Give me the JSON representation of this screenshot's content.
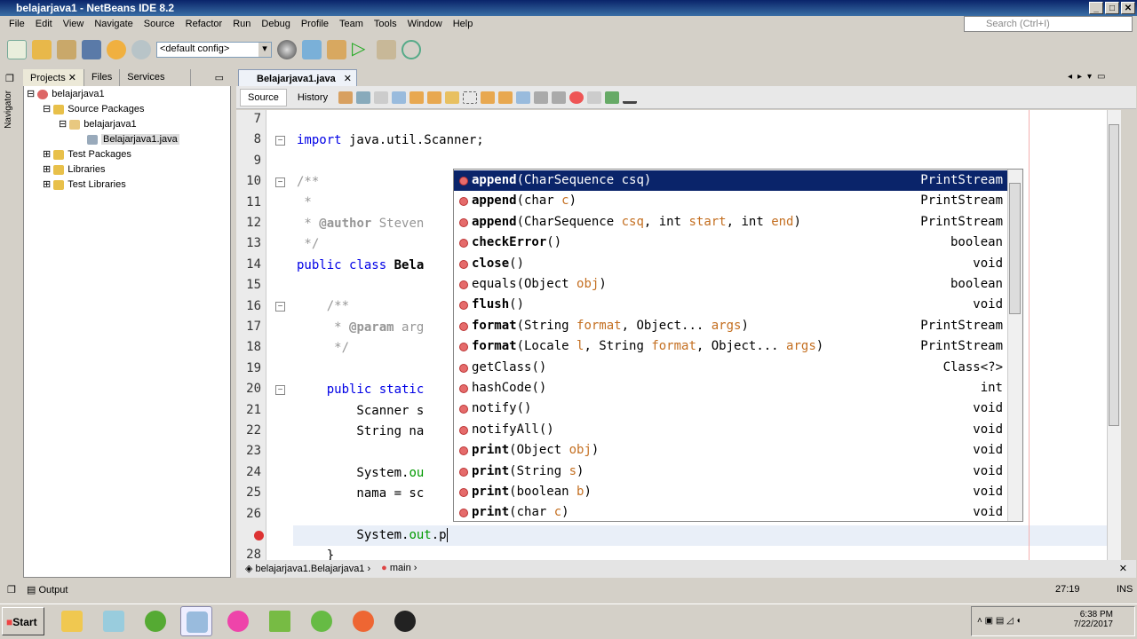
{
  "window": {
    "title": "belajarjava1 - NetBeans IDE 8.2"
  },
  "menu": [
    "File",
    "Edit",
    "View",
    "Navigate",
    "Source",
    "Refactor",
    "Run",
    "Debug",
    "Profile",
    "Team",
    "Tools",
    "Window",
    "Help"
  ],
  "search": {
    "placeholder": "Search (Ctrl+I)"
  },
  "toolbar": {
    "config": "<default config>"
  },
  "left_tabs": [
    "Projects",
    "Files",
    "Services"
  ],
  "navigator_label": "Navigator",
  "tree": [
    "belajarjava1",
    "Source Packages",
    "belajarjava1",
    "Belajarjava1.java",
    "Test Packages",
    "Libraries",
    "Test Libraries"
  ],
  "editor": {
    "tab": "Belajarjava1.java",
    "view_tabs": [
      "Source",
      "History"
    ],
    "line_numbers": [
      "7",
      "8",
      "9",
      "10",
      "11",
      "12",
      "13",
      "14",
      "15",
      "16",
      "17",
      "18",
      "19",
      "20",
      "21",
      "22",
      "23",
      "24",
      "25",
      "26",
      "",
      "28"
    ],
    "code": {
      "l8a": "import",
      "l8b": " java.util.Scanner;",
      "l10": "/**",
      "l11": " *",
      "l12a": " * ",
      "l12b": "@author",
      "l12c": " Steven",
      "l13": " */",
      "l14a": "public class ",
      "l14b": "Bela",
      "l16": "    /**",
      "l17a": "     * ",
      "l17b": "@param",
      "l17c": " arg",
      "l18": "     */",
      "l20": "    public static",
      "l21": "        Scanner s",
      "l22": "        String na",
      "l24a": "        System.",
      "l24b": "ou",
      "l25": "        nama = sc",
      "l27a": "        System.",
      "l27b": "out",
      "l27c": ".p",
      "l28": "    }"
    }
  },
  "completion": [
    {
      "name": "append",
      "args": "(CharSequence ",
      "p": "csq",
      "end": ")",
      "ret": "PrintStream",
      "bold": true
    },
    {
      "name": "append",
      "args": "(char ",
      "p": "c",
      "end": ")",
      "ret": "PrintStream",
      "bold": true
    },
    {
      "name": "append",
      "args": "(CharSequence ",
      "p": "csq",
      "mid": ", int ",
      "p2": "start",
      "mid2": ", int ",
      "p3": "end",
      "end": ")",
      "ret": "PrintStream",
      "bold": true
    },
    {
      "name": "checkError",
      "args": "()",
      "ret": "boolean",
      "bold": true
    },
    {
      "name": "close",
      "args": "()",
      "ret": "void",
      "bold": true
    },
    {
      "name": "equals",
      "args": "(Object ",
      "p": "obj",
      "end": ")",
      "ret": "boolean",
      "bold": false
    },
    {
      "name": "flush",
      "args": "()",
      "ret": "void",
      "bold": true
    },
    {
      "name": "format",
      "args": "(String ",
      "p": "format",
      "mid": ", Object... ",
      "p2": "args",
      "end": ")",
      "ret": "PrintStream",
      "bold": true
    },
    {
      "name": "format",
      "args": "(Locale ",
      "p": "l",
      "mid": ", String ",
      "p2": "format",
      "mid2": ", Object... ",
      "p3": "args",
      "end": ")",
      "ret": "PrintStream",
      "bold": true
    },
    {
      "name": "getClass",
      "args": "()",
      "ret": "Class<?>",
      "bold": false
    },
    {
      "name": "hashCode",
      "args": "()",
      "ret": "int",
      "bold": false
    },
    {
      "name": "notify",
      "args": "()",
      "ret": "void",
      "bold": false
    },
    {
      "name": "notifyAll",
      "args": "()",
      "ret": "void",
      "bold": false
    },
    {
      "name": "print",
      "args": "(Object ",
      "p": "obj",
      "end": ")",
      "ret": "void",
      "bold": true
    },
    {
      "name": "print",
      "args": "(String ",
      "p": "s",
      "end": ")",
      "ret": "void",
      "bold": true
    },
    {
      "name": "print",
      "args": "(boolean ",
      "p": "b",
      "end": ")",
      "ret": "void",
      "bold": true
    },
    {
      "name": "print",
      "args": "(char ",
      "p": "c",
      "end": ")",
      "ret": "void",
      "bold": true
    }
  ],
  "breadcrumb": [
    "belajarjava1.Belajarjava1",
    "main"
  ],
  "status": {
    "output": "Output",
    "position": "27:19",
    "mode": "INS"
  },
  "taskbar": {
    "start": "Start",
    "time": "6:38 PM",
    "date": "7/22/2017"
  },
  "colors": {
    "selection": "#0a246a",
    "keyword": "#0000e6",
    "field": "#009900",
    "comment": "#969696"
  }
}
